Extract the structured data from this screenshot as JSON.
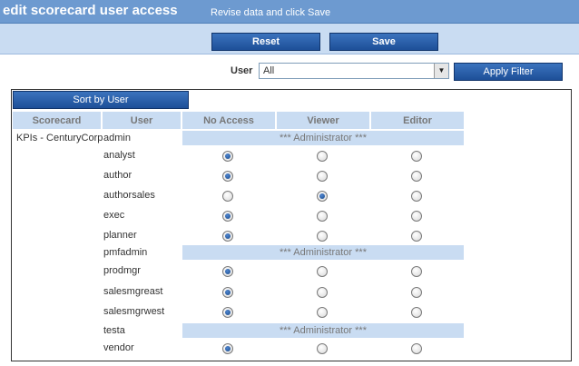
{
  "header": {
    "title": "edit scorecard user access",
    "subtitle": "Revise data and click Save"
  },
  "toolbar": {
    "reset_label": "Reset",
    "save_label": "Save"
  },
  "filter": {
    "label": "User",
    "selected": "All",
    "apply_label": "Apply Filter"
  },
  "table": {
    "sort_label": "Sort by User",
    "columns": [
      "Scorecard",
      "User",
      "No Access",
      "Viewer",
      "Editor"
    ],
    "scorecard": "KPIs - CenturyCorp",
    "admin_text": "*** Administrator ***",
    "rows": [
      {
        "user": "admin",
        "admin": true,
        "access": ""
      },
      {
        "user": "analyst",
        "admin": false,
        "access": "No Access"
      },
      {
        "user": "author",
        "admin": false,
        "access": "No Access"
      },
      {
        "user": "authorsales",
        "admin": false,
        "access": "Viewer"
      },
      {
        "user": "exec",
        "admin": false,
        "access": "No Access"
      },
      {
        "user": "planner",
        "admin": false,
        "access": "No Access"
      },
      {
        "user": "pmfadmin",
        "admin": true,
        "access": ""
      },
      {
        "user": "prodmgr",
        "admin": false,
        "access": "No Access"
      },
      {
        "user": "salesmgreast",
        "admin": false,
        "access": "No Access"
      },
      {
        "user": "salesmgrwest",
        "admin": false,
        "access": "No Access"
      },
      {
        "user": "testa",
        "admin": true,
        "access": ""
      },
      {
        "user": "vendor",
        "admin": false,
        "access": "No Access"
      }
    ]
  },
  "colors": {
    "header_bg": "#6d9ad0",
    "band_bg": "#c9dcf2",
    "button_bg": "#2a5ea8"
  }
}
